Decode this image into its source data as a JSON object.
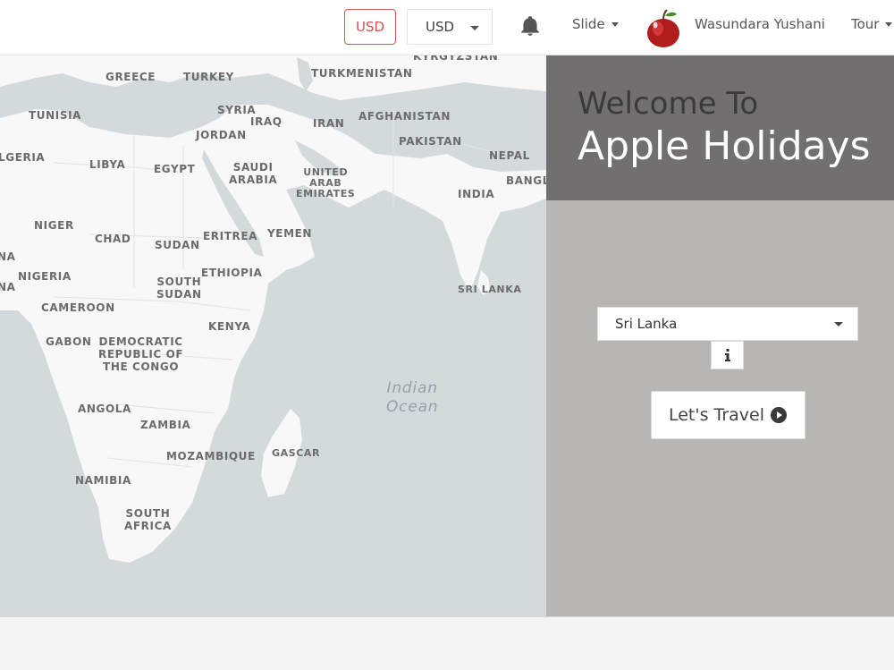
{
  "topbar": {
    "currency_button": "USD",
    "currency_select": "USD",
    "menu_slide": "Slide",
    "user_name": "Wasundara Yushani",
    "menu_tour": "Tour"
  },
  "map": {
    "labels": [
      {
        "text": "GREECE"
      },
      {
        "text": "TURKEY"
      },
      {
        "text": "TURKMENISTAN"
      },
      {
        "text": "KYRGYZSTAN"
      },
      {
        "text": "TUNISIA"
      },
      {
        "text": "SYRIA"
      },
      {
        "text": "IRAQ"
      },
      {
        "text": "IRAN"
      },
      {
        "text": "AFGHANISTAN"
      },
      {
        "text": "JORDAN"
      },
      {
        "text": "PAKISTAN"
      },
      {
        "text": "LGERIA"
      },
      {
        "text": "LIBYA"
      },
      {
        "text": "EGYPT"
      },
      {
        "text": "SAUDI\nARABIA"
      },
      {
        "text": "UNITED\nARAB\nEMIRATES"
      },
      {
        "text": "NEPAL"
      },
      {
        "text": "BANGL"
      },
      {
        "text": "INDIA"
      },
      {
        "text": "NIGER"
      },
      {
        "text": "CHAD"
      },
      {
        "text": "SUDAN"
      },
      {
        "text": "ERITREA"
      },
      {
        "text": "YEMEN"
      },
      {
        "text": "NIGERIA"
      },
      {
        "text": "ETHIOPIA"
      },
      {
        "text": "SOUTH\nSUDAN"
      },
      {
        "text": "SRI LANKA"
      },
      {
        "text": "CAMEROON"
      },
      {
        "text": "KENYA"
      },
      {
        "text": "GABON"
      },
      {
        "text": "DEMOCRATIC\nREPUBLIC OF\nTHE CONGO"
      },
      {
        "text": "ANGOLA"
      },
      {
        "text": "ZAMBIA"
      },
      {
        "text": "MOZAMBIQUE"
      },
      {
        "text": "GASCAR"
      },
      {
        "text": "NAMIBIA"
      },
      {
        "text": "SOUTH\nAFRICA"
      },
      {
        "text": "NA"
      },
      {
        "text": "NA"
      }
    ],
    "ocean_label": "Indian\nOcean"
  },
  "welcome": {
    "subtitle": "Welcome To",
    "title": "Apple Holidays"
  },
  "search": {
    "destination": "Sri Lanka",
    "info_label": "i",
    "travel_button": "Let's Travel"
  }
}
